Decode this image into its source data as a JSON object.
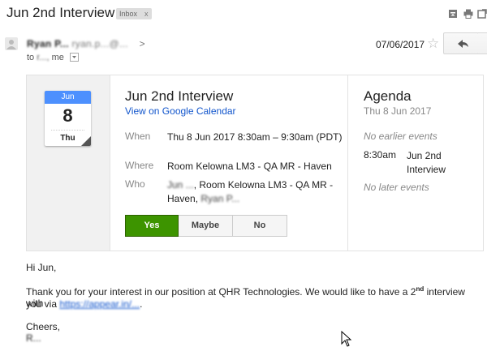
{
  "header": {
    "subject": "Jun 2nd Interview",
    "label_badge": "Inbox",
    "label_remove": "x",
    "icons": [
      "archive-icon",
      "print-icon",
      "popout-icon"
    ]
  },
  "message": {
    "sender_name": "Ryan P...",
    "sender_email": "ryan.p...@...",
    "sender_caret": ">",
    "recipient_prefix": "to",
    "recipient_blurred": "r...,",
    "recipient_me": "me",
    "date": "07/06/2017",
    "star": "☆"
  },
  "invite": {
    "month": "Jun",
    "day": "8",
    "weekday": "Thu",
    "title": "Jun 2nd Interview",
    "view_link": "View on Google Calendar",
    "when_label": "When",
    "when_value": "Thu 8 Jun 2017 8:30am – 9:30am (PDT)",
    "where_label": "Where",
    "where_value": "Room Kelowna LM3 - QA MR - Haven",
    "who_label": "Who",
    "who_blurred": "Jun ...",
    "who_value": ", Room Kelowna LM3 - QA MR - Haven,",
    "who_blurred2": "Ryan P...",
    "rsvp": {
      "yes": "Yes",
      "maybe": "Maybe",
      "no": "No"
    }
  },
  "agenda": {
    "title": "Agenda",
    "date": "Thu 8 Jun 2017",
    "no_earlier": "No earlier events",
    "event_time": "8:30am",
    "event_title": "Jun 2nd Interview",
    "no_later": "No later events"
  },
  "body": {
    "greeting": "Hi Jun,",
    "line1_a": "Thank you for your interest in our position at QHR Technologies.  We would like to have a 2",
    "line1_sup": "nd",
    "line1_b": " interview with",
    "line2_a": "you via ",
    "line2_link": "https://appear.in/...",
    "line2_b": ".",
    "cheers": "Cheers,",
    "signoff": "R..."
  },
  "colors": {
    "yes_green": "#3d9400",
    "link_blue": "#1155cc",
    "calendar_blue": "#4d90fe"
  }
}
